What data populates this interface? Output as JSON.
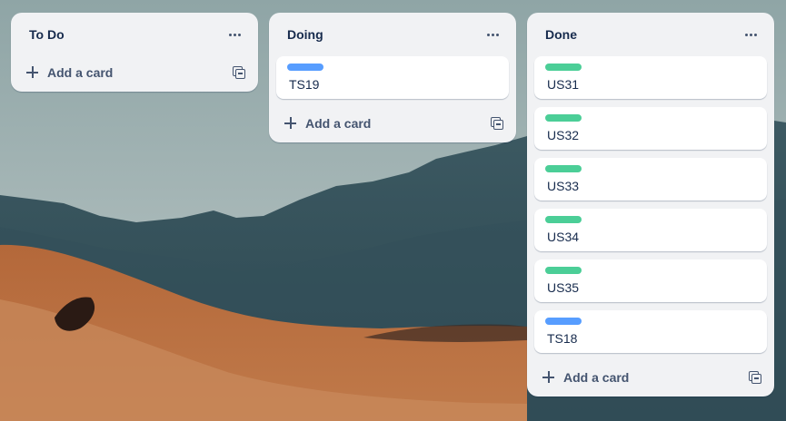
{
  "colors": {
    "label_blue": "#579dff",
    "label_green": "#4bce97",
    "list_bg": "#f1f2f4"
  },
  "lists": [
    {
      "title": "To Do",
      "menu_icon": "more-horizontal-icon",
      "cards": [],
      "add_label": "Add a card",
      "template_icon": "card-template-icon"
    },
    {
      "title": "Doing",
      "menu_icon": "more-horizontal-icon",
      "cards": [
        {
          "title": "TS19",
          "label_color": "blue"
        }
      ],
      "add_label": "Add a card",
      "template_icon": "card-template-icon"
    },
    {
      "title": "Done",
      "menu_icon": "more-horizontal-icon",
      "cards": [
        {
          "title": "US31",
          "label_color": "green"
        },
        {
          "title": "US32",
          "label_color": "green"
        },
        {
          "title": "US33",
          "label_color": "green"
        },
        {
          "title": "US34",
          "label_color": "green"
        },
        {
          "title": "US35",
          "label_color": "green"
        },
        {
          "title": "TS18",
          "label_color": "blue"
        }
      ],
      "add_label": "Add a card",
      "template_icon": "card-template-icon"
    }
  ]
}
